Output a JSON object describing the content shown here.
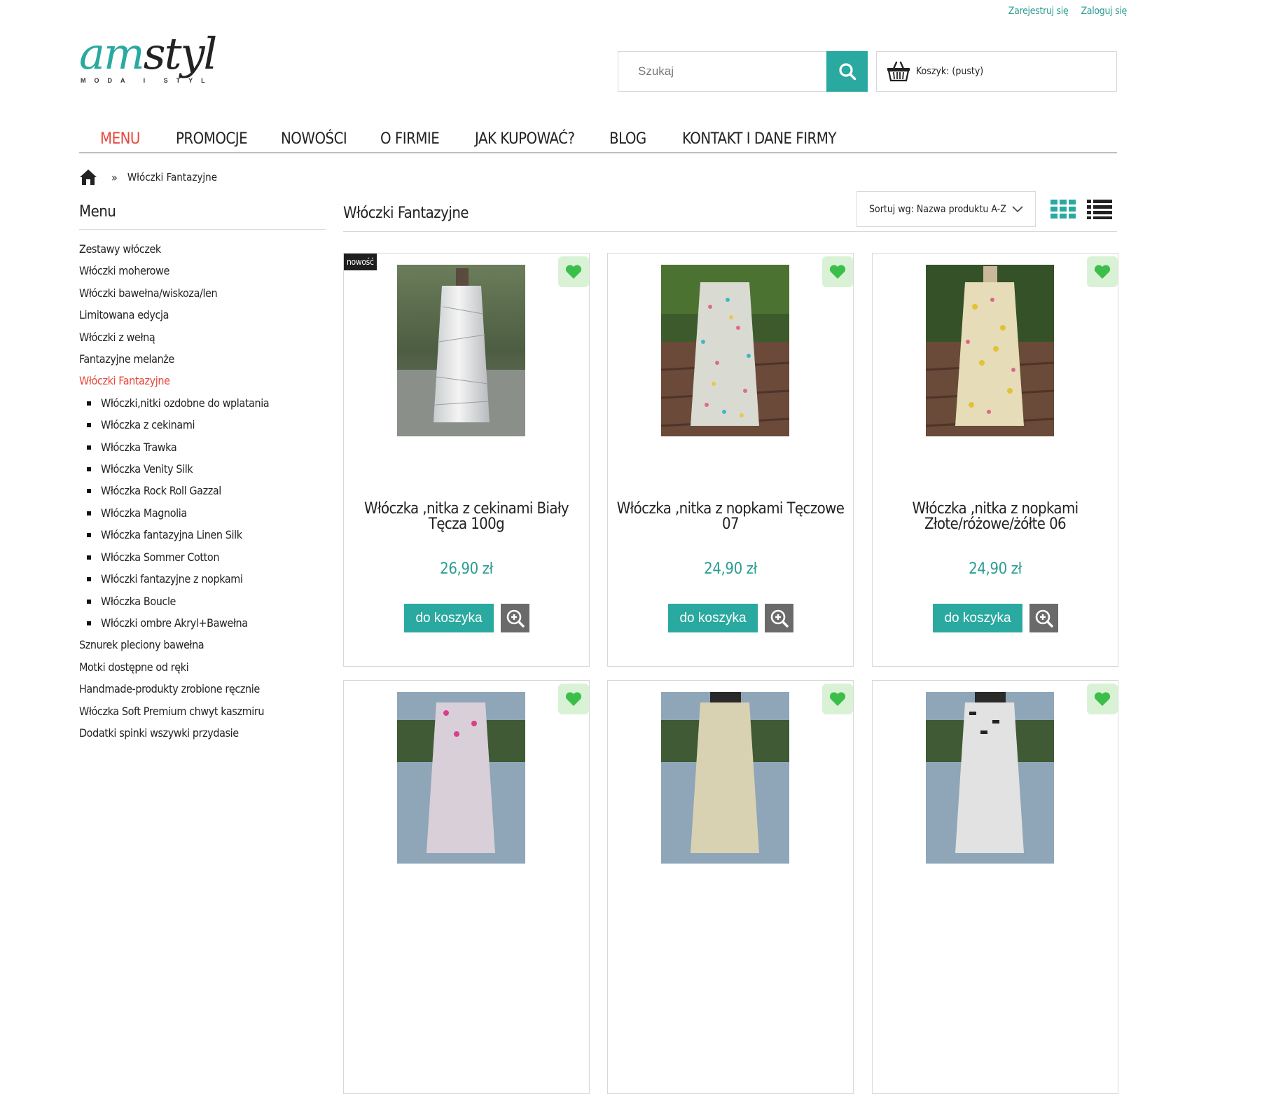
{
  "header": {
    "register_label": "Zarejestruj się",
    "login_label": "Zaloguj się",
    "logo_text": "amstyl",
    "logo_sub": "MODA I STYL",
    "search_placeholder": "Szukaj",
    "cart_label": "Koszyk: (pusty)"
  },
  "nav": {
    "items": [
      "MENU",
      "PROMOCJE",
      "NOWOŚCI",
      "O FIRMIE",
      "JAK KUPOWAĆ?",
      "BLOG",
      "KONTAKT I DANE FIRMY"
    ],
    "active_index": 0
  },
  "breadcrumb": {
    "separator": "»",
    "current": "Włóczki Fantazyjne"
  },
  "sidebar": {
    "title": "Menu",
    "items": [
      "Zestawy włóczek",
      "Włóczki moherowe",
      "Włóczki bawełna/wiskoza/len",
      "Limitowana edycja",
      "Włóczki z wełną",
      "Fantazyjne melanże",
      "Włóczki Fantazyjne",
      "Włóczki,nitki ozdobne do wplatania",
      "Włóczka z cekinami",
      "Włóczka Trawka",
      "Włóczka Venity Silk",
      "Włóczka Rock Roll Gazzal",
      "Włóczka Magnolia",
      "Włóczka fantazyjna Linen Silk",
      "Włóczka Sommer Cotton",
      "Włóczki fantazyjne z nopkami",
      "Włóczka Boucle",
      "Włóczki ombre Akryl+Bawełna",
      "Sznurek pleciony bawełna",
      "Motki dostępne od ręki",
      "Handmade-produkty zrobione ręcznie",
      "Włóczka Soft Premium chwyt kaszmiru",
      "Dodatki spinki wszywki przydasie"
    ]
  },
  "main": {
    "title": "Włóczki Fantazyjne",
    "sort_label": "Sortuj wg: Nazwa produktu A-Z"
  },
  "products": [
    {
      "badge": "nowość",
      "name": "Włóczka ,nitka z cekinami Biały Tęcza 100g",
      "price": "26,90 zł",
      "add_label": "do koszyka"
    },
    {
      "badge": "",
      "name": "Włóczka ,nitka z nopkami Tęczowe 07",
      "price": "24,90 zł",
      "add_label": "do koszyka"
    },
    {
      "badge": "",
      "name": "Włóczka ,nitka z nopkami Złote/różowe/żółte 06",
      "price": "24,90 zł",
      "add_label": "do koszyka"
    }
  ],
  "colors": {
    "accent": "#2aa9a0",
    "active_nav": "#e8473b",
    "favorite_bg": "#d9f2d6",
    "favorite_heart": "#3cbf4a"
  },
  "icons": {
    "search": "search-icon",
    "cart": "basket-icon",
    "home": "home-icon",
    "favorite": "heart-icon",
    "zoom": "zoom-in-icon",
    "grid_view": "grid-view-icon",
    "list_view": "list-view-icon"
  }
}
